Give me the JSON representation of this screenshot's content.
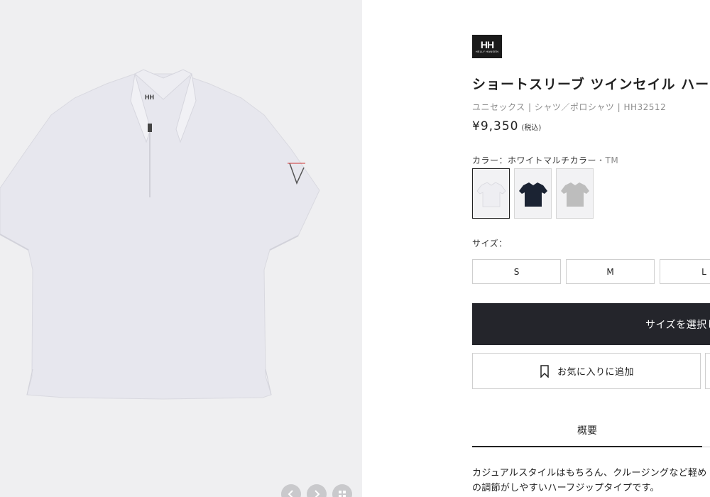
{
  "brand": {
    "logo_mark": "HH",
    "logo_sub": "HELLY HANSEN"
  },
  "product": {
    "title": "ショートスリーブ ツインセイル ハーフ",
    "breadcrumb": "ユニセックス | シャツ／ポロシャツ | HH32512",
    "price": "¥9,350",
    "tax_note": "(税込)"
  },
  "color": {
    "label": "カラー：ホワイトマルチカラー",
    "code": "・TM",
    "swatches": [
      {
        "name": "white",
        "hex": "#eeeef2",
        "selected": true
      },
      {
        "name": "navy",
        "hex": "#1b2333",
        "selected": false
      },
      {
        "name": "gray",
        "hex": "#bdbdbd",
        "selected": false
      }
    ]
  },
  "size": {
    "label": "サイズ：",
    "options": [
      "S",
      "M",
      "L"
    ]
  },
  "cart": {
    "label": "サイズを選択し"
  },
  "favorite": {
    "label": "お気に入りに追加",
    "icon": "bookmark-icon"
  },
  "tabs": {
    "overview": "概要"
  },
  "description": {
    "line1": "カジュアルスタイルはもちろん、クルージングなど軽め",
    "line2": "の調節がしやすいハーフジップタイプです。"
  }
}
